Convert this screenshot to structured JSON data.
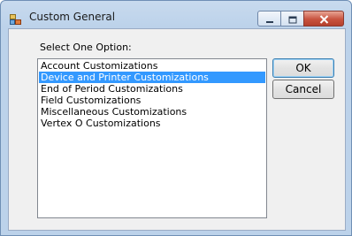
{
  "window": {
    "title": "Custom General",
    "icon": "app-icon",
    "controls": {
      "minimize": "minimize-icon",
      "maximize": "maximize-icon",
      "close": "close-icon"
    }
  },
  "prompt_label": "Select One Option:",
  "list": {
    "items": [
      "Account Customizations",
      "Device and Printer Customizations",
      "End of Period Customizations",
      "Field Customizations",
      "Miscellaneous Customizations",
      "Vertex O Customizations"
    ],
    "selected": "Device and Printer Customizations"
  },
  "buttons": {
    "ok": "OK",
    "cancel": "Cancel"
  },
  "colors": {
    "selection": "#3399ff",
    "close_button": "#c8533f"
  }
}
